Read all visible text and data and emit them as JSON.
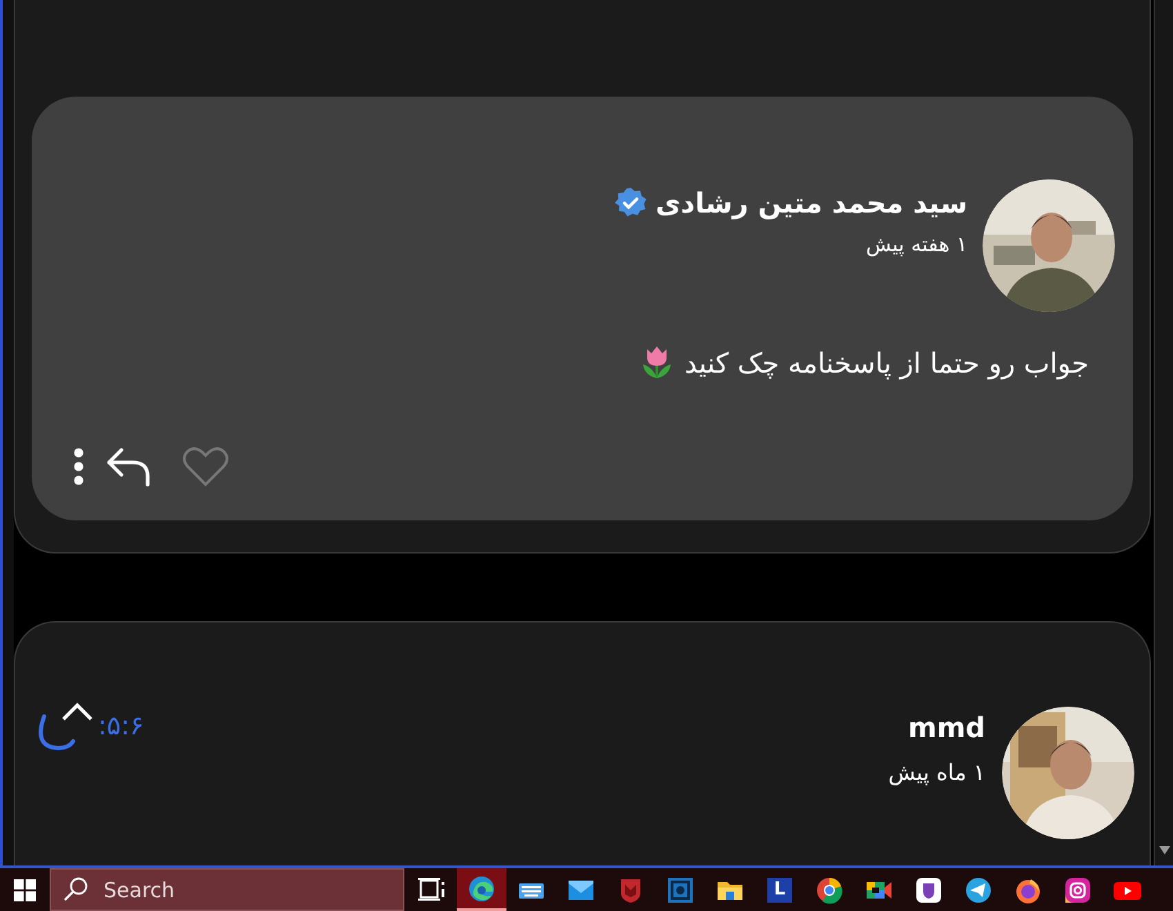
{
  "comments": [
    {
      "author": "سید محمد متین رشادی",
      "verified": true,
      "time": "۱ هفته پیش",
      "text": "جواب رو حتما از پاسخنامه چک کنید",
      "liked": false
    },
    {
      "author": "mmd",
      "verified": false,
      "time": "۱ ماه پیش"
    }
  ],
  "timer": ":۵:۶",
  "taskbar": {
    "search_placeholder": "Search",
    "apps": [
      {
        "kind": "taskview",
        "selected": false
      },
      {
        "kind": "browser",
        "selected": true
      },
      {
        "kind": "keyboard",
        "selected": false
      },
      {
        "kind": "mail",
        "selected": false
      },
      {
        "kind": "shield",
        "selected": false
      },
      {
        "kind": "capture",
        "selected": false
      },
      {
        "kind": "folder",
        "selected": false
      },
      {
        "kind": "letter",
        "label": "L",
        "selected": false
      },
      {
        "kind": "chrome",
        "selected": false
      },
      {
        "kind": "video",
        "selected": false
      },
      {
        "kind": "badge",
        "selected": false
      },
      {
        "kind": "plane",
        "selected": false
      },
      {
        "kind": "fox",
        "selected": false
      },
      {
        "kind": "camera",
        "selected": false
      },
      {
        "kind": "play",
        "selected": false
      }
    ]
  }
}
